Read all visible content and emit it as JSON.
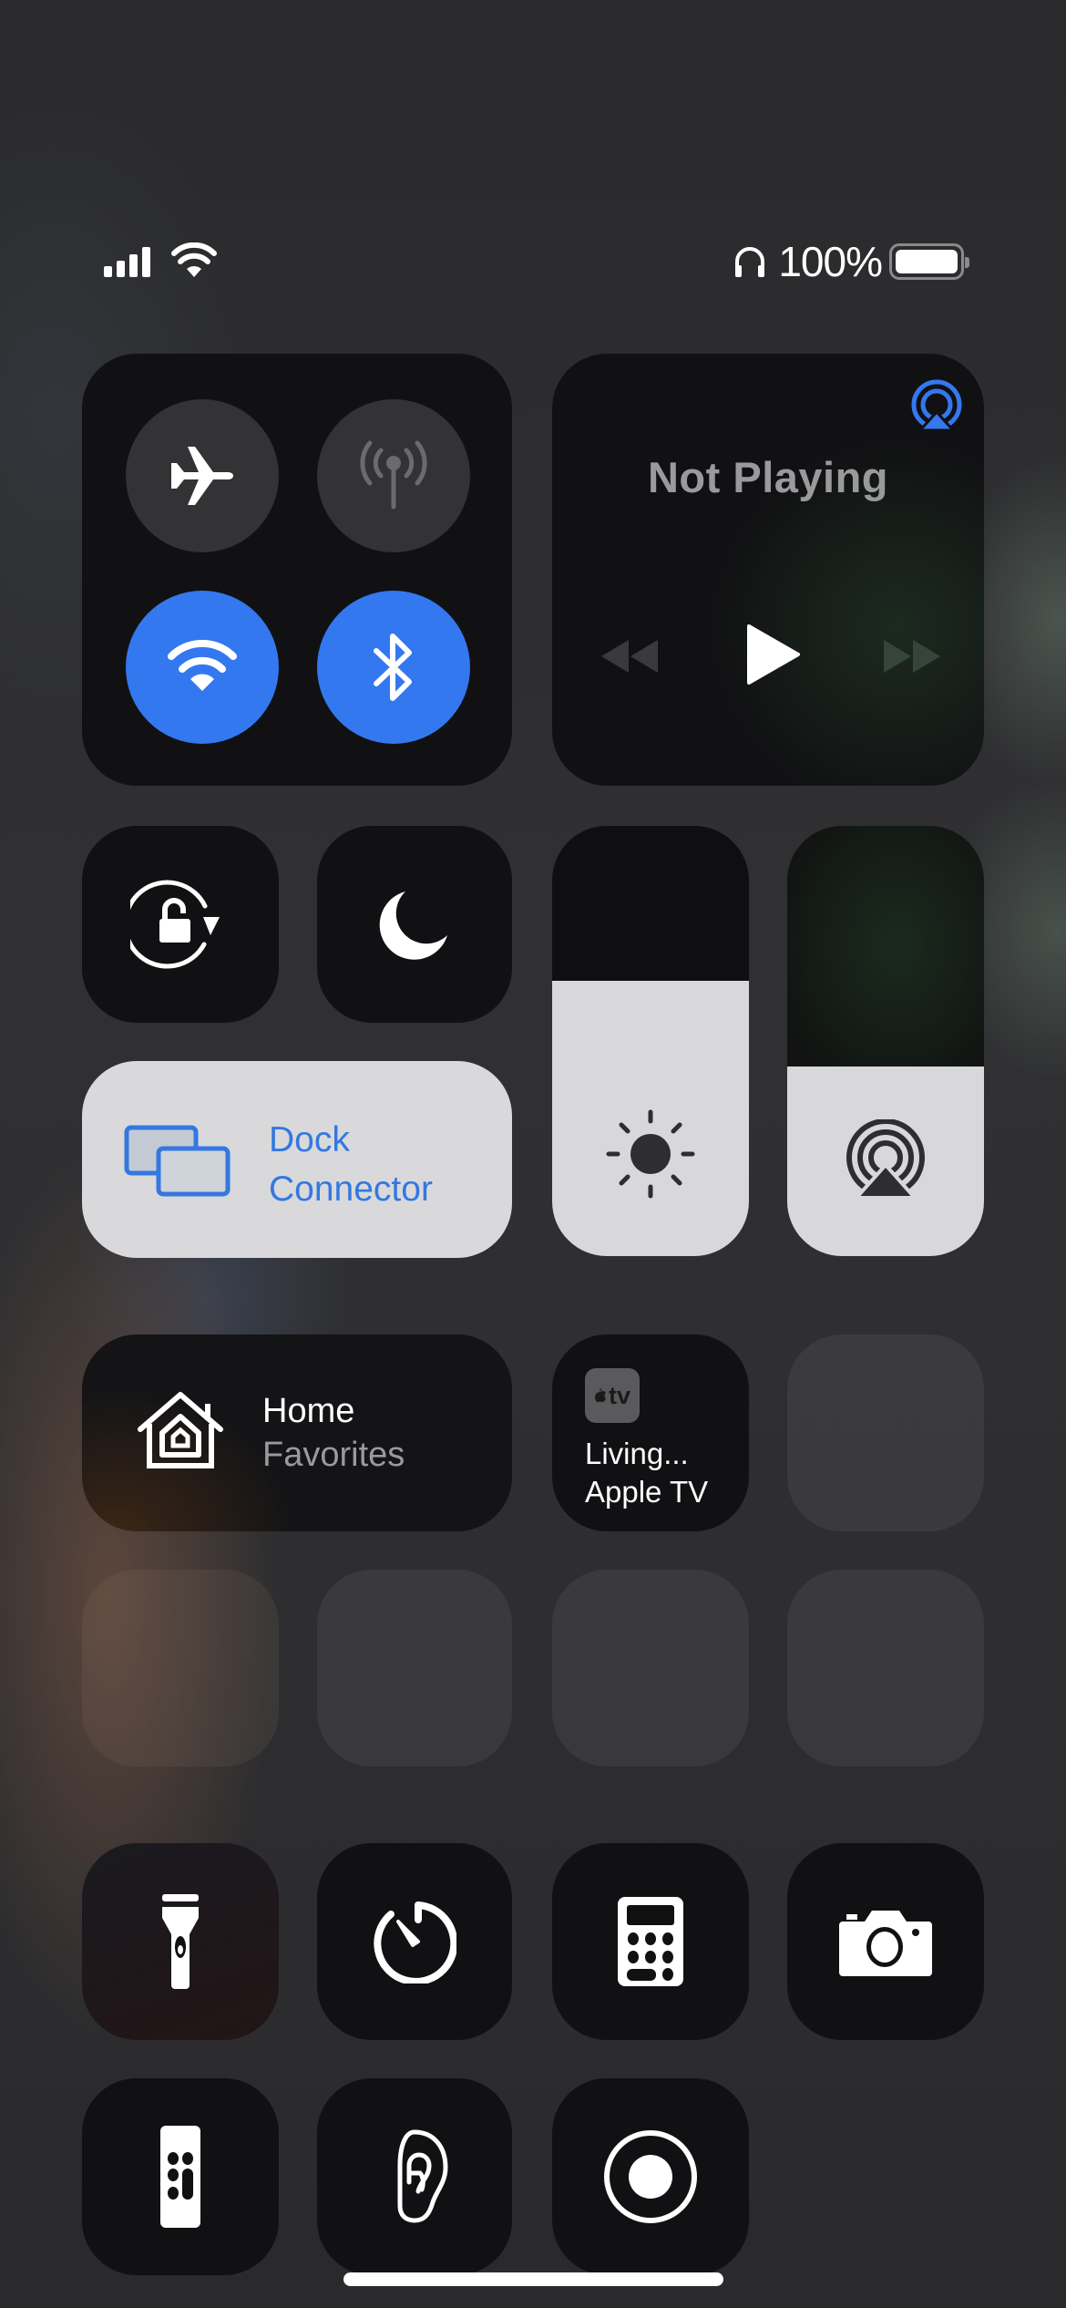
{
  "status_bar": {
    "signal_bars": 4,
    "wifi_icon": "wifi-icon",
    "headphones_icon": "headphones-icon",
    "battery_percent": "100%",
    "battery_level": 1.0
  },
  "connectivity": {
    "airplane_mode": {
      "label": "Airplane Mode",
      "icon": "airplane-icon",
      "on": false
    },
    "cellular_data": {
      "label": "Cellular Data",
      "icon": "antenna-icon",
      "on": false
    },
    "wifi": {
      "label": "Wi-Fi",
      "icon": "wifi-icon",
      "on": true
    },
    "bluetooth": {
      "label": "Bluetooth",
      "icon": "bluetooth-icon",
      "on": true
    }
  },
  "media": {
    "status": "Not Playing",
    "airplay_icon": "airplay-icon",
    "controls": [
      "rewind",
      "play",
      "fast-forward"
    ]
  },
  "toggles": {
    "orientation_lock": {
      "icon": "orientation-lock-icon"
    },
    "do_not_disturb": {
      "icon": "moon-icon"
    }
  },
  "screen_mirroring": {
    "line1": "Dock",
    "line2": "Connector",
    "icon": "screen-mirroring-icon"
  },
  "sliders": {
    "brightness": {
      "icon": "sun-icon",
      "level": 0.64
    },
    "volume": {
      "icon": "airplay-audio-icon",
      "level": 0.44
    }
  },
  "home": {
    "title": "Home",
    "subtitle": "Favorites",
    "icon": "home-icon"
  },
  "apple_tv": {
    "badge": "tv",
    "badge_text": "tv",
    "line1": "Living...",
    "line2": "Apple TV"
  },
  "tools": [
    {
      "name": "flashlight",
      "icon": "flashlight-icon"
    },
    {
      "name": "timer",
      "icon": "timer-icon"
    },
    {
      "name": "calculator",
      "icon": "calculator-icon"
    },
    {
      "name": "camera",
      "icon": "camera-icon"
    },
    {
      "name": "apple-tv-remote",
      "icon": "remote-icon"
    },
    {
      "name": "hearing",
      "icon": "ear-icon"
    },
    {
      "name": "screen-recording",
      "icon": "record-icon"
    }
  ],
  "colors": {
    "accent_blue": "#3478f0",
    "tile_dark": "#111113",
    "tile_light": "#d9d9db",
    "text_secondary": "#9a9a9c"
  }
}
